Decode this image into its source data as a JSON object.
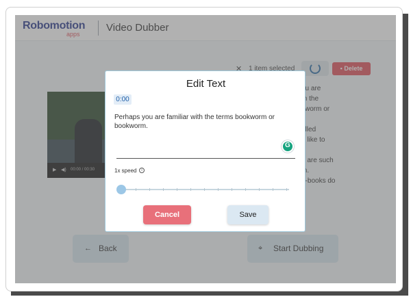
{
  "header": {
    "logo_main": "Robomotion",
    "logo_sub": "apps",
    "title": "Video Dubber"
  },
  "selection": {
    "close_glyph": "✕",
    "text": "1 item selected",
    "delete_label": "Delete"
  },
  "video": {
    "time": "00:00 / 00:30"
  },
  "right_text": [
    "ou are",
    "th the",
    "kworm or",
    "",
    "alled",
    "o like to",
    "",
    "u are such",
    "m.",
    "e-books do"
  ],
  "footer": {
    "back_label": "Back",
    "back_arrow": "←",
    "start_label": "Start Dubbing",
    "start_icon": "⌖"
  },
  "modal": {
    "title": "Edit Text",
    "timestamp": "0:00",
    "text": "Perhaps you are familiar with the terms bookworm or bookworm.",
    "speed_label": "1x speed",
    "speed_value": 0,
    "cancel_label": "Cancel",
    "save_label": "Save"
  },
  "colors": {
    "accent": "#2d6fa8",
    "danger": "#e0505a",
    "cancel": "#e8707a",
    "save": "#dbe8f2"
  }
}
